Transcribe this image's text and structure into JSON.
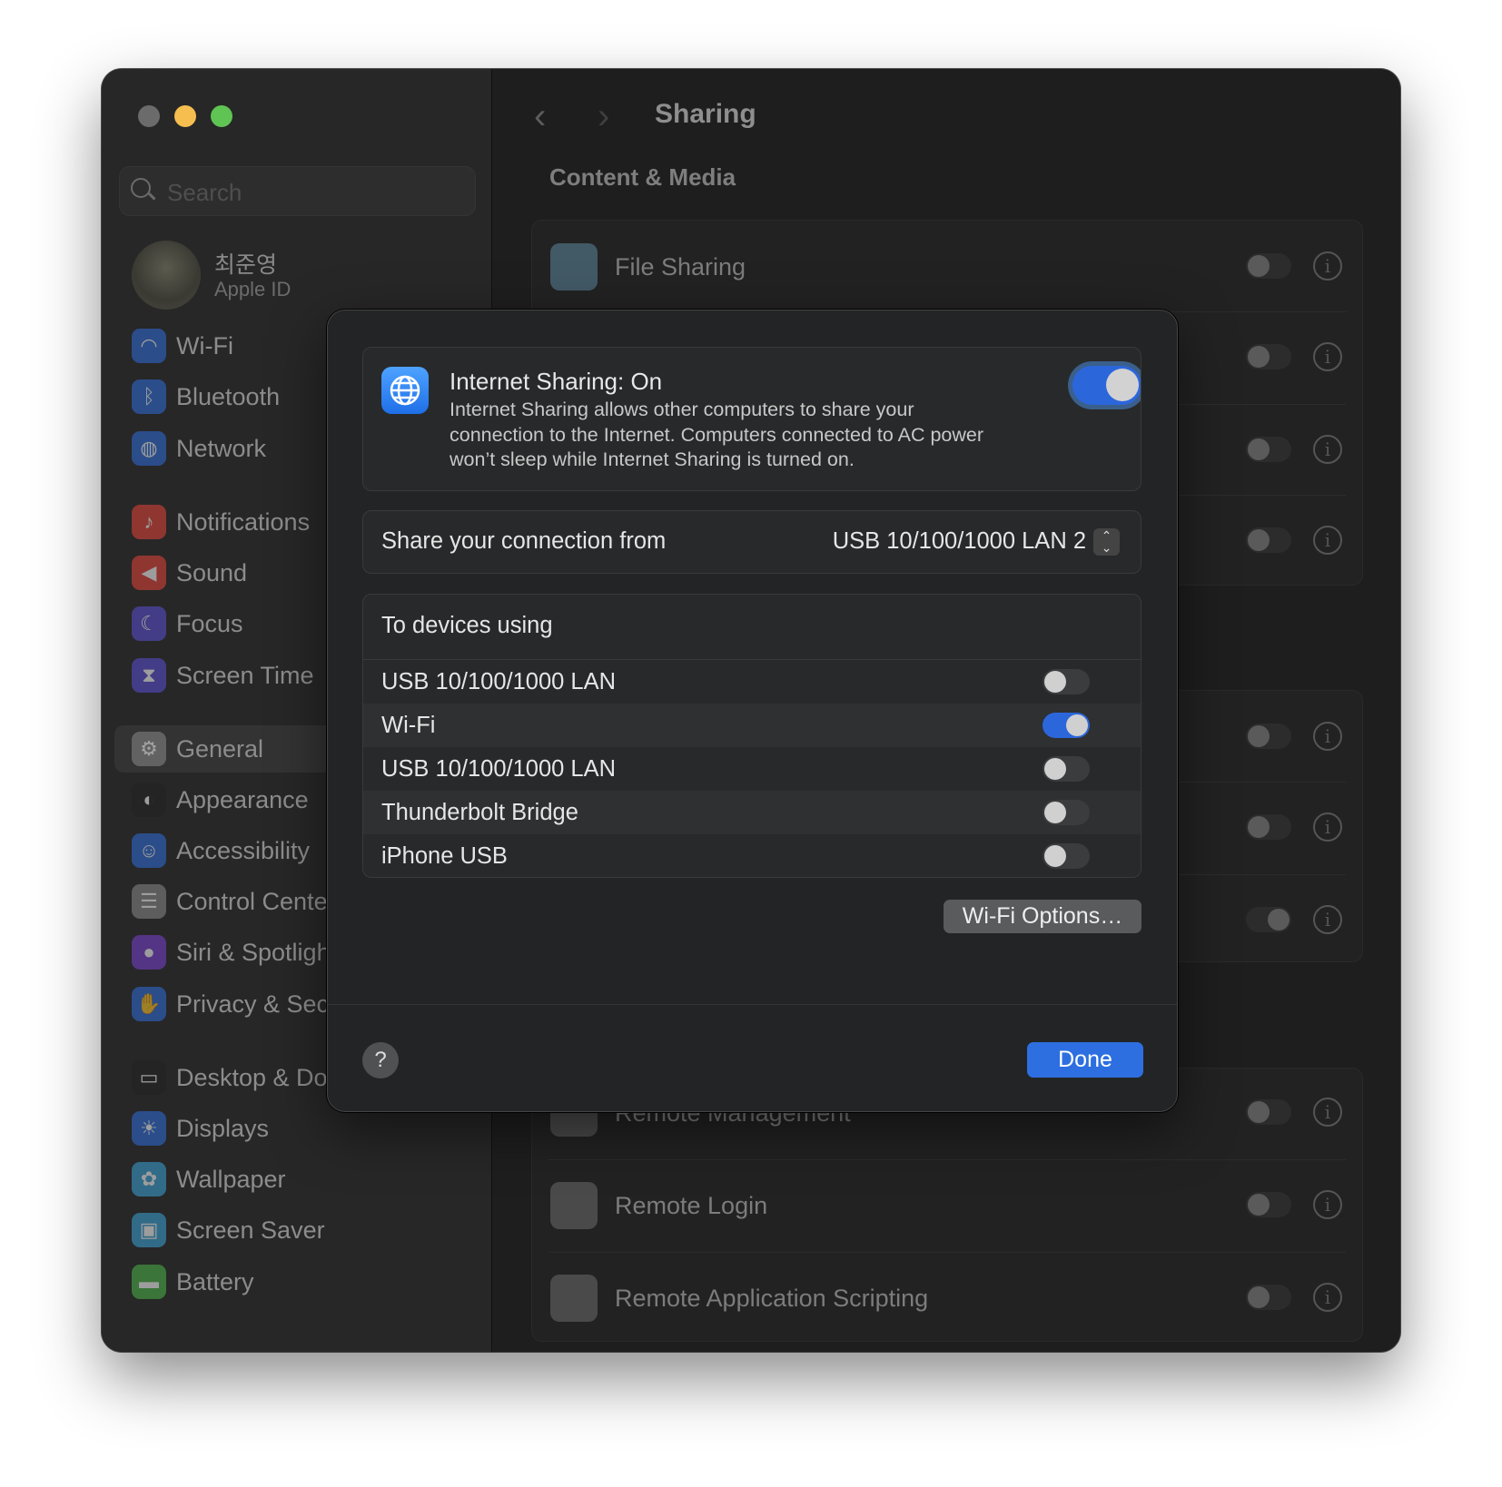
{
  "window": {
    "traffic_lights": [
      "#6b6b6b",
      "#f5be4f",
      "#5fc453"
    ]
  },
  "sidebar": {
    "search_placeholder": "Search",
    "user": {
      "name": "최준영",
      "subtitle": "Apple ID"
    },
    "items": [
      {
        "label": "Wi-Fi",
        "icon": "wifi-icon",
        "color": "#2f6cdc"
      },
      {
        "label": "Bluetooth",
        "icon": "bluetooth-icon",
        "color": "#2f6cdc"
      },
      {
        "label": "Network",
        "icon": "globe-icon",
        "color": "#2f6cdc"
      },
      {
        "label": "Notifications",
        "icon": "bell-icon",
        "color": "#e5433a"
      },
      {
        "label": "Sound",
        "icon": "speaker-icon",
        "color": "#e5433a"
      },
      {
        "label": "Focus",
        "icon": "moon-icon",
        "color": "#5b4fd6"
      },
      {
        "label": "Screen Time",
        "icon": "hourglass-icon",
        "color": "#5b4fd6"
      },
      {
        "label": "General",
        "icon": "gear-icon",
        "color": "#8a8a8a",
        "selected": true
      },
      {
        "label": "Appearance",
        "icon": "appearance-icon",
        "color": "#222222"
      },
      {
        "label": "Accessibility",
        "icon": "accessibility-icon",
        "color": "#2f6cdc"
      },
      {
        "label": "Control Center",
        "icon": "control-center-icon",
        "color": "#8a8a8a"
      },
      {
        "label": "Siri & Spotlight",
        "icon": "siri-icon",
        "color": "#7a3fd0"
      },
      {
        "label": "Privacy & Security",
        "icon": "hand-icon",
        "color": "#2f6cdc"
      },
      {
        "label": "Desktop & Dock",
        "icon": "dock-icon",
        "color": "#222222"
      },
      {
        "label": "Displays",
        "icon": "sun-icon",
        "color": "#2f6cdc"
      },
      {
        "label": "Wallpaper",
        "icon": "flower-icon",
        "color": "#3aa4d8"
      },
      {
        "label": "Screen Saver",
        "icon": "screen-saver-icon",
        "color": "#3aa4d8"
      },
      {
        "label": "Battery",
        "icon": "battery-icon",
        "color": "#4cb548"
      }
    ]
  },
  "main": {
    "title": "Sharing",
    "section": "Content & Media",
    "rows": [
      {
        "label": "File Sharing",
        "on": false
      },
      {
        "label": "Remote Management",
        "on": false
      },
      {
        "label": "Remote Login",
        "on": false
      },
      {
        "label": "Remote Application Scripting",
        "on": false
      }
    ]
  },
  "dialog": {
    "title": "Internet Sharing: On",
    "description": "Internet Sharing allows other computers to share your connection to the Internet. Computers connected to AC power won’t sleep while Internet Sharing is turned on.",
    "enabled": true,
    "share_from_label": "Share your connection from",
    "share_from_value": "USB 10/100/1000 LAN 2",
    "devices_header": "To devices using",
    "devices": [
      {
        "label": "USB 10/100/1000 LAN",
        "on": false
      },
      {
        "label": "Wi-Fi",
        "on": true
      },
      {
        "label": "USB 10/100/1000 LAN",
        "on": false
      },
      {
        "label": "Thunderbolt Bridge",
        "on": false
      },
      {
        "label": "iPhone USB",
        "on": false
      }
    ],
    "wifi_options": "Wi-Fi Options…",
    "help": "?",
    "done": "Done"
  }
}
